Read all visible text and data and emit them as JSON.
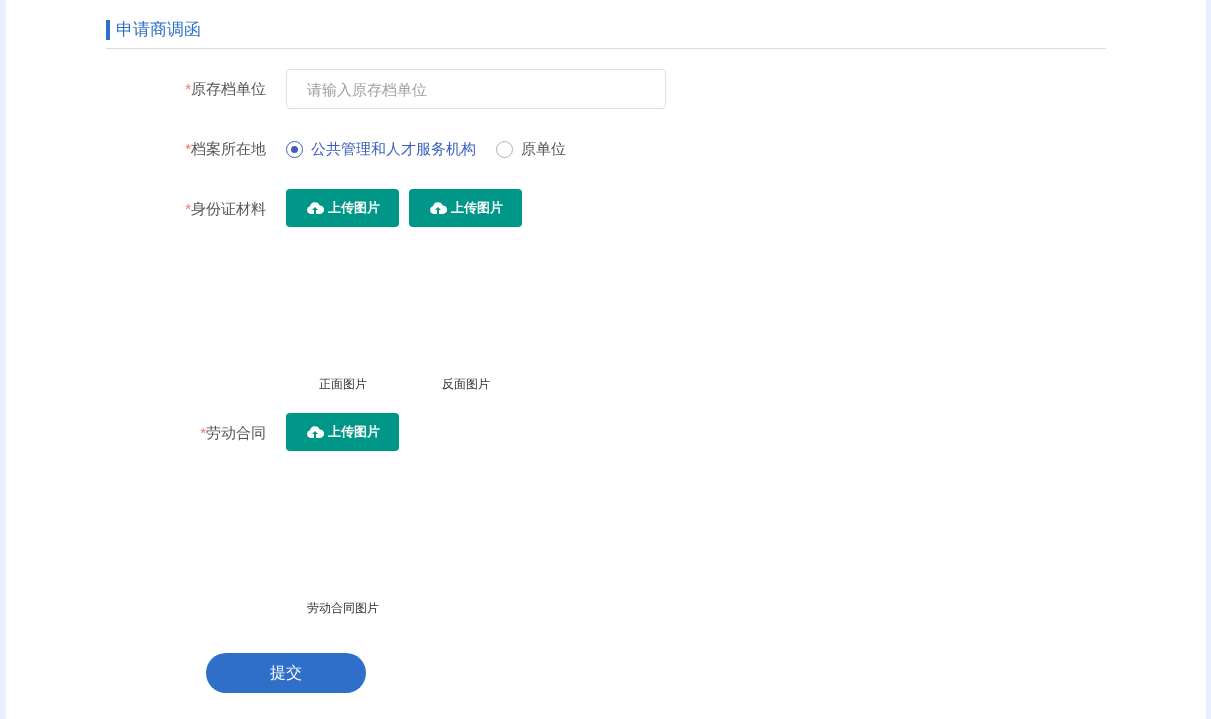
{
  "section_title": "申请商调函",
  "fields": [
    {
      "kind": "text",
      "required_mark": "*",
      "label": "原存档单位",
      "placeholder": "请输入原存档单位"
    },
    {
      "kind": "radio",
      "required_mark": "*",
      "label": "档案所在地",
      "options": [
        {
          "label": "公共管理和人才服务机构",
          "selected": true
        },
        {
          "label": "原单位",
          "selected": false
        }
      ]
    },
    {
      "kind": "upload",
      "required_mark": "*",
      "label": "身份证材料",
      "uploads": [
        {
          "button": "上传图片",
          "caption": "正面图片"
        },
        {
          "button": "上传图片",
          "caption": "反面图片"
        }
      ]
    },
    {
      "kind": "upload",
      "required_mark": "*",
      "label": "劳动合同",
      "uploads": [
        {
          "button": "上传图片",
          "caption": "劳动合同图片"
        }
      ]
    }
  ],
  "submit": "提交"
}
